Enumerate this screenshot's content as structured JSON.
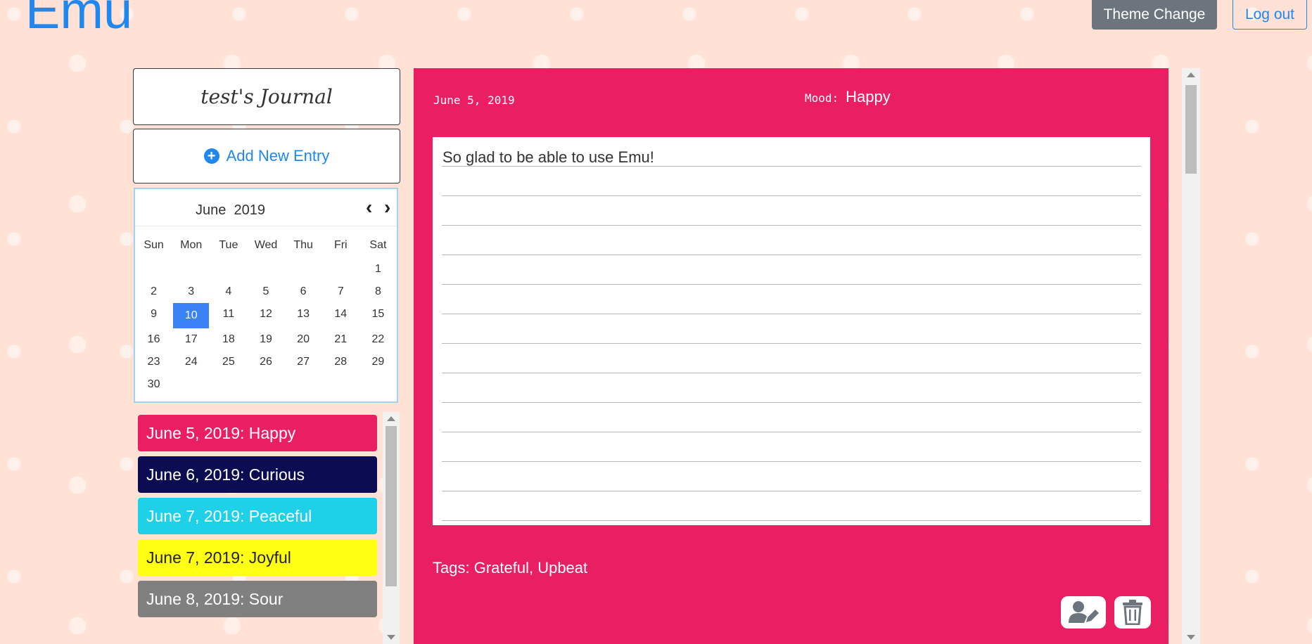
{
  "app": {
    "logo": "Emu"
  },
  "header": {
    "theme_button": "Theme Change",
    "logout_button": "Log out"
  },
  "sidebar": {
    "journal_title": "test's Journal",
    "add_entry_label": "Add New Entry"
  },
  "calendar": {
    "month": "June",
    "year": "2019",
    "weekdays": [
      "Sun",
      "Mon",
      "Tue",
      "Wed",
      "Thu",
      "Fri",
      "Sat"
    ],
    "weeks": [
      [
        "",
        "",
        "",
        "",
        "",
        "",
        "1"
      ],
      [
        "2",
        "3",
        "4",
        "5",
        "6",
        "7",
        "8"
      ],
      [
        "9",
        "10",
        "11",
        "12",
        "13",
        "14",
        "15"
      ],
      [
        "16",
        "17",
        "18",
        "19",
        "20",
        "21",
        "22"
      ],
      [
        "23",
        "24",
        "25",
        "26",
        "27",
        "28",
        "29"
      ],
      [
        "30",
        "",
        "",
        "",
        "",
        "",
        ""
      ]
    ],
    "selected_day": "10"
  },
  "entries": [
    {
      "label": "June 5, 2019: Happy",
      "bg": "#e91e63",
      "fg": "#ffffff"
    },
    {
      "label": "June 6, 2019: Curious",
      "bg": "#0b0c52",
      "fg": "#ffffff"
    },
    {
      "label": "June 7, 2019: Peaceful",
      "bg": "#1ed1e8",
      "fg": "#ffffff"
    },
    {
      "label": "June 7, 2019: Joyful",
      "bg": "#ffff14",
      "fg": "#222222"
    },
    {
      "label": "June 8, 2019: Sour",
      "bg": "#808080",
      "fg": "#ffffff"
    }
  ],
  "entry": {
    "date": "June 5, 2019",
    "mood_label": "Mood:",
    "mood": "Happy",
    "text": "So glad to be able to use Emu!",
    "tags_label": "Tags:",
    "tags": "Grateful, Upbeat",
    "panel_color": "#e91e63"
  },
  "icons": {
    "add": "plus-circle-icon",
    "prev": "chevron-left-icon",
    "next": "chevron-right-icon",
    "edit": "user-edit-icon",
    "delete": "trash-icon"
  }
}
